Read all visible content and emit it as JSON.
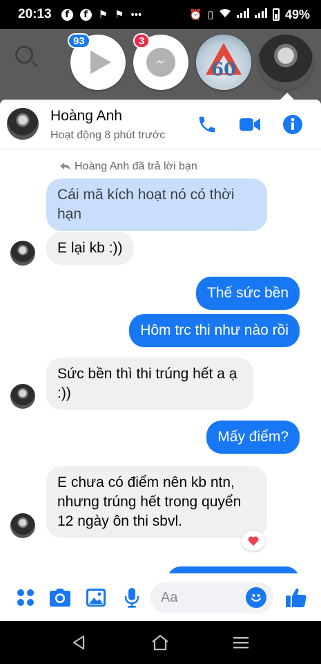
{
  "status_bar": {
    "time": "20:13",
    "battery": "49%"
  },
  "chat_heads": {
    "play_badge": "93",
    "messenger_badge": "3"
  },
  "conversation": {
    "contact_name": "Hoàng Anh",
    "contact_status": "Hoạt động 8 phút trước",
    "reply_note": "Hoàng Anh đã trả lời bạn",
    "messages": [
      {
        "sender": "me",
        "quoted": true,
        "text": "Cái mã kích hoạt nó có thời hạn"
      },
      {
        "sender": "them",
        "text": "E lại kb :))"
      },
      {
        "sender": "me",
        "text": "Thế sức bền"
      },
      {
        "sender": "me",
        "text": "Hôm trc thi như nào rồi"
      },
      {
        "sender": "them",
        "text": "Sức bền thì thi trúng hết a ạ :))"
      },
      {
        "sender": "me",
        "text": "Mấy điểm?"
      },
      {
        "sender": "them",
        "text": "E chưa có điểm nên kb ntn, nhưng trúng hết trong quyển 12 ngày ôn thi sbvl.",
        "reaction": "heart"
      }
    ]
  },
  "composer": {
    "placeholder": "Aa"
  },
  "colors": {
    "accent": "#1877f2",
    "incoming_bubble": "#f0f0f0",
    "quoted_bubble": "#c9defa",
    "reaction_heart": "#f33e58"
  }
}
